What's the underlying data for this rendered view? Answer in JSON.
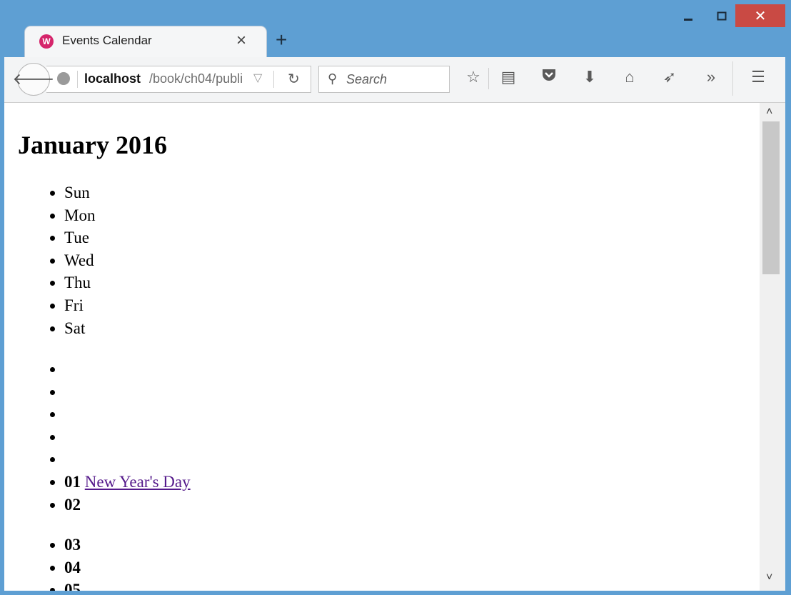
{
  "browser": {
    "tab_title": "Events Calendar",
    "tab_favicon_letter": "W",
    "url_host": "localhost",
    "url_path": "/book/ch04/publi",
    "search_placeholder": "Search",
    "window_controls": {
      "minimize": "–",
      "maximize": "☐",
      "close": "✕"
    },
    "toolbar_icons": [
      "star-icon",
      "reading-list-icon",
      "pocket-icon",
      "download-icon",
      "home-icon",
      "send-icon",
      "overflow-icon",
      "menu-icon"
    ],
    "accent_color": "#5e9fd3",
    "close_color": "#c94a44"
  },
  "page": {
    "title": "January 2016",
    "weekdays": [
      "Sun",
      "Mon",
      "Tue",
      "Wed",
      "Thu",
      "Fri",
      "Sat"
    ],
    "week1": [
      {
        "day": "",
        "event": ""
      },
      {
        "day": "",
        "event": ""
      },
      {
        "day": "",
        "event": ""
      },
      {
        "day": "",
        "event": ""
      },
      {
        "day": "",
        "event": ""
      },
      {
        "day": "01",
        "event": "New Year's Day"
      },
      {
        "day": "02",
        "event": ""
      }
    ],
    "week2": [
      {
        "day": "03",
        "event": ""
      },
      {
        "day": "04",
        "event": ""
      },
      {
        "day": "05",
        "event": ""
      }
    ],
    "link_color": "#551a8b"
  }
}
